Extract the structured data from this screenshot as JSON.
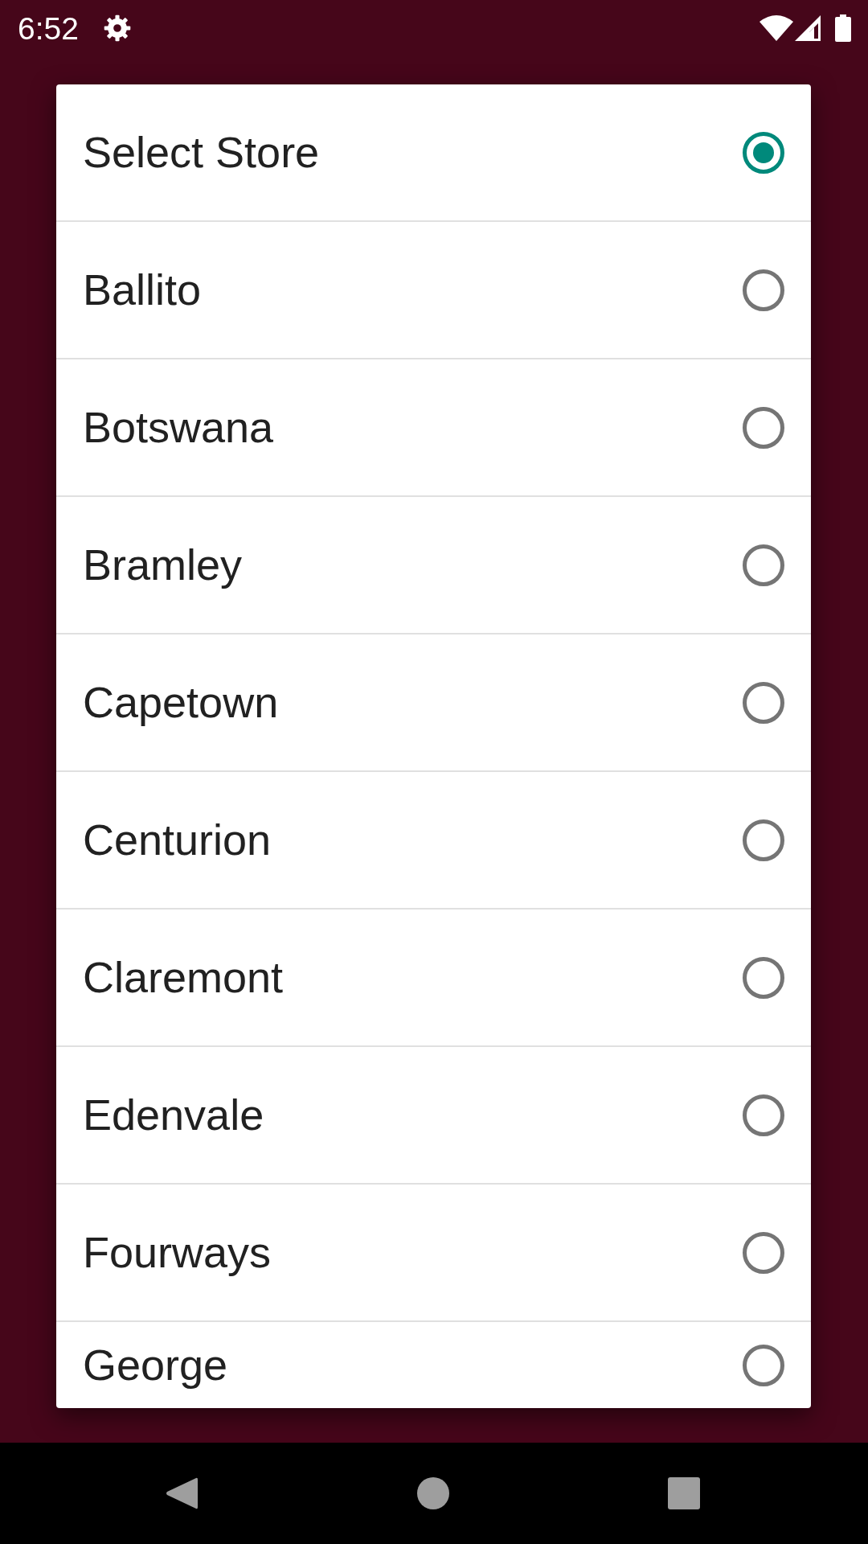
{
  "status_bar": {
    "time": "6:52"
  },
  "dialog": {
    "options": [
      {
        "label": "Select Store",
        "selected": true
      },
      {
        "label": "Ballito",
        "selected": false
      },
      {
        "label": "Botswana",
        "selected": false
      },
      {
        "label": "Bramley",
        "selected": false
      },
      {
        "label": "Capetown",
        "selected": false
      },
      {
        "label": "Centurion",
        "selected": false
      },
      {
        "label": "Claremont",
        "selected": false
      },
      {
        "label": "Edenvale",
        "selected": false
      },
      {
        "label": "Fourways",
        "selected": false
      },
      {
        "label": "George",
        "selected": false
      }
    ]
  }
}
